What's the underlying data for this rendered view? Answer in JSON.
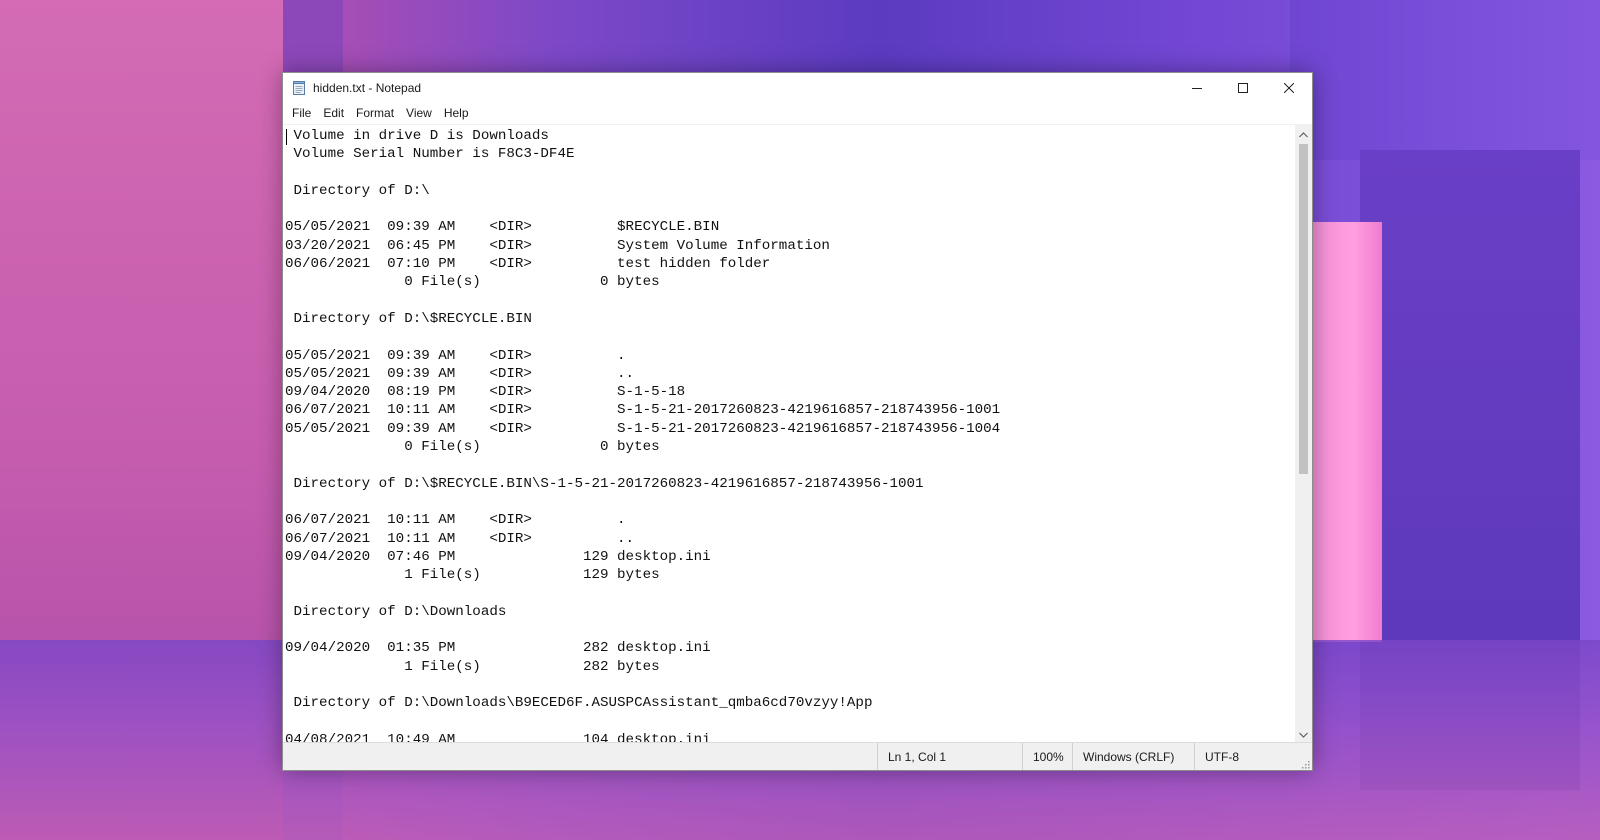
{
  "window": {
    "title": "hidden.txt - Notepad"
  },
  "icons": {
    "app": "notepad-icon",
    "minimize": "minimize-icon",
    "maximize": "maximize-icon",
    "close": "close-icon",
    "scroll_up": "chevron-up-icon",
    "scroll_down": "chevron-down-icon",
    "resize": "resize-grip-icon"
  },
  "menu": {
    "items": [
      "File",
      "Edit",
      "Format",
      "View",
      "Help"
    ]
  },
  "document": {
    "text": " Volume in drive D is Downloads\n Volume Serial Number is F8C3-DF4E\n\n Directory of D:\\\n\n05/05/2021  09:39 AM    <DIR>          $RECYCLE.BIN\n03/20/2021  06:45 PM    <DIR>          System Volume Information\n06/06/2021  07:10 PM    <DIR>          test hidden folder\n              0 File(s)              0 bytes\n\n Directory of D:\\$RECYCLE.BIN\n\n05/05/2021  09:39 AM    <DIR>          .\n05/05/2021  09:39 AM    <DIR>          ..\n09/04/2020  08:19 PM    <DIR>          S-1-5-18\n06/07/2021  10:11 AM    <DIR>          S-1-5-21-2017260823-4219616857-218743956-1001\n05/05/2021  09:39 AM    <DIR>          S-1-5-21-2017260823-4219616857-218743956-1004\n              0 File(s)              0 bytes\n\n Directory of D:\\$RECYCLE.BIN\\S-1-5-21-2017260823-4219616857-218743956-1001\n\n06/07/2021  10:11 AM    <DIR>          .\n06/07/2021  10:11 AM    <DIR>          ..\n09/04/2020  07:46 PM               129 desktop.ini\n              1 File(s)            129 bytes\n\n Directory of D:\\Downloads\n\n09/04/2020  01:35 PM               282 desktop.ini\n              1 File(s)            282 bytes\n\n Directory of D:\\Downloads\\B9ECED6F.ASUSPCAssistant_qmba6cd70vzyy!App\n\n04/08/2021  10:49 AM               104 desktop.ini"
  },
  "status": {
    "position": "Ln 1, Col 1",
    "zoom": "100%",
    "line_endings": "Windows (CRLF)",
    "encoding": "UTF-8"
  }
}
